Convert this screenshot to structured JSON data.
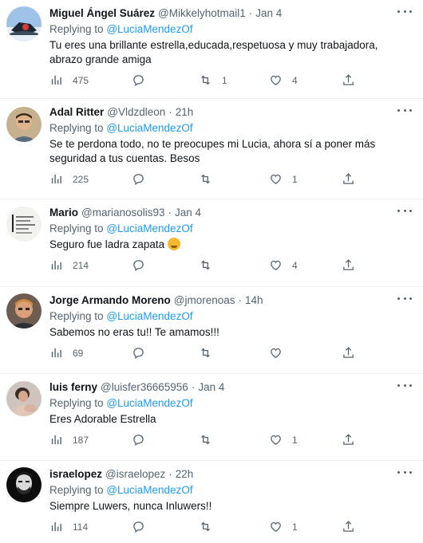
{
  "icons": {
    "views": "views-icon",
    "reply": "reply-icon",
    "retweet": "retweet-icon",
    "like": "like-icon",
    "share": "share-icon",
    "more": "more-icon"
  },
  "colors": {
    "accent": "#1d9bf0",
    "muted": "#536471",
    "text": "#0f1419",
    "divider": "#eff3f4"
  },
  "replying_prefix": "Replying to",
  "tweets": [
    {
      "name": "Miguel Ángel Suárez",
      "handle": "@Mikkelyhotmail1",
      "dot": "·",
      "time": "Jan 4",
      "reply_to": "@LuciaMendezOf",
      "text": "Tu eres una brillante estrella,educada,respetuosa y muy trabajadora, abrazo grande amiga",
      "views": "475",
      "replies": "",
      "retweets": "1",
      "likes": "4"
    },
    {
      "name": "Adal Ritter",
      "handle": "@Vldzdleon",
      "dot": "·",
      "time": "21h",
      "reply_to": "@LuciaMendezOf",
      "text": "Se te perdona todo, no te preocupes mi Lucia, ahora sí a poner más seguridad a tus cuentas. Besos",
      "views": "225",
      "replies": "",
      "retweets": "",
      "likes": "1"
    },
    {
      "name": "Mario",
      "handle": "@marianosolis93",
      "dot": "·",
      "time": "Jan 4",
      "reply_to": "@LuciaMendezOf",
      "text": "Seguro fue ladra zapata",
      "views": "214",
      "replies": "",
      "retweets": "",
      "likes": "4"
    },
    {
      "name": "Jorge Armando Moreno",
      "handle": "@jmorenoas",
      "dot": "·",
      "time": "14h",
      "reply_to": "@LuciaMendezOf",
      "text": "Sabemos no eras tu!! Te amamos!!!",
      "views": "69",
      "replies": "",
      "retweets": "",
      "likes": ""
    },
    {
      "name": "luis ferny",
      "handle": "@luisfer36665956",
      "dot": "·",
      "time": "Jan 4",
      "reply_to": "@LuciaMendezOf",
      "text": "Eres Adorable Estrella",
      "views": "187",
      "replies": "",
      "retweets": "",
      "likes": "1"
    },
    {
      "name": "israelopez",
      "handle": "@israelopez",
      "dot": "·",
      "time": "22h",
      "reply_to": "@LuciaMendezOf",
      "text": "Siempre Luwers, nunca Inluwers!!",
      "views": "114",
      "replies": "",
      "retweets": "",
      "likes": "1"
    }
  ]
}
